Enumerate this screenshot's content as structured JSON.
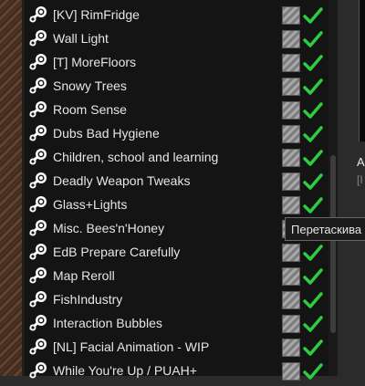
{
  "mods": [
    {
      "label": "[KV] RimFridge",
      "status": "active"
    },
    {
      "label": "Wall Light",
      "status": "active"
    },
    {
      "label": "[T] MoreFloors",
      "status": "active"
    },
    {
      "label": "Snowy Trees",
      "status": "active"
    },
    {
      "label": "Room Sense",
      "status": "active"
    },
    {
      "label": "Dubs Bad Hygiene",
      "status": "active"
    },
    {
      "label": "Children, school and learning",
      "status": "active"
    },
    {
      "label": "Deadly Weapon Tweaks",
      "status": "active"
    },
    {
      "label": "Glass+Lights",
      "status": "active"
    },
    {
      "label": "Misc. Bees'n'Honey",
      "status": "active"
    },
    {
      "label": "EdB Prepare Carefully",
      "status": "active"
    },
    {
      "label": "Map Reroll",
      "status": "active"
    },
    {
      "label": "FishIndustry",
      "status": "active"
    },
    {
      "label": "Interaction Bubbles",
      "status": "active"
    },
    {
      "label": "[NL] Facial Animation - WIP",
      "status": "active"
    },
    {
      "label": "While You're Up / PUAH+",
      "status": "active"
    }
  ],
  "icons": {
    "source": "steam-workshop-icon",
    "status": "hatched-status-icon",
    "enabled": "green-checkmark-icon"
  },
  "right_panel": {
    "title": "A",
    "subtitle": "[I"
  },
  "tooltip": {
    "text": "Перетаскива"
  },
  "colors": {
    "accent_green": "#2ecc40",
    "panel_bg": "#141414",
    "text": "#e6e6e6"
  }
}
